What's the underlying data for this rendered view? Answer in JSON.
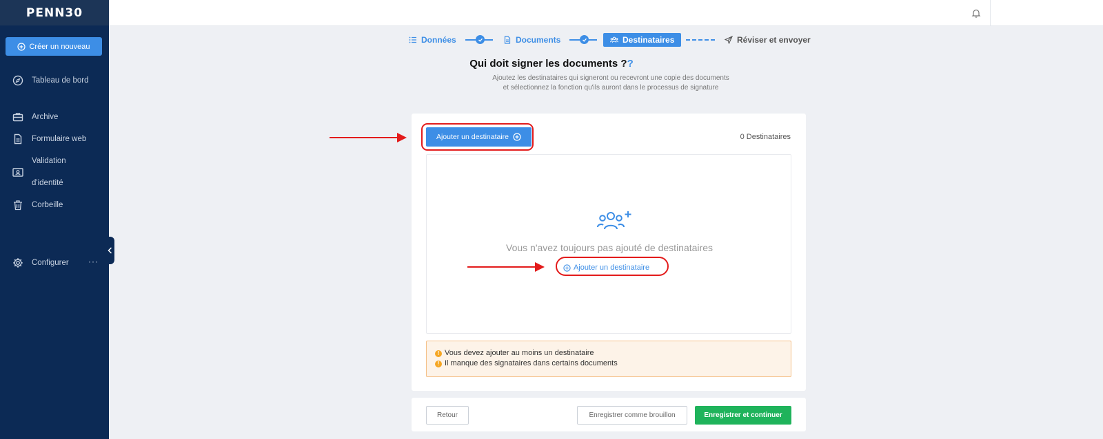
{
  "colors": {
    "sidebar_bg": "#0c2a55",
    "accent": "#3d8ee6",
    "success": "#1fb35b",
    "warning_bg": "#fdf3e8",
    "annotation": "#e31b1b"
  },
  "sidebar": {
    "logo": "PENN30",
    "create_label": "Créer un nouveau",
    "items": [
      {
        "label": "Tableau de bord",
        "icon": "compass-icon"
      },
      {
        "label": "Archive",
        "icon": "briefcase-icon"
      },
      {
        "label": "Formulaire web",
        "icon": "document-icon"
      },
      {
        "label": "Validation",
        "label2": "d'identité",
        "icon": "id-card-icon"
      },
      {
        "label": "Corbeille",
        "icon": "trash-icon"
      },
      {
        "label": "Configurer",
        "icon": "gear-icon"
      }
    ],
    "more": "···"
  },
  "stepper": {
    "steps": [
      {
        "label": "Données",
        "state": "done",
        "icon": "list-icon"
      },
      {
        "label": "Documents",
        "state": "done",
        "icon": "file-icon"
      },
      {
        "label": "Destinataires",
        "state": "active",
        "icon": "users-icon"
      },
      {
        "label": "Réviser et envoyer",
        "state": "pending",
        "icon": "send-icon"
      }
    ]
  },
  "main": {
    "title": "Qui doit signer les documents ?",
    "title_q": "?",
    "subtitle": "Ajoutez les destinataires qui signeront ou recevront une copie des documents et sélectionnez la fonction qu'ils auront dans le processus de signature",
    "add_button": "Ajouter un destinataire",
    "recipient_count": "0 Destinataires",
    "empty_text": "Vous n'avez toujours pas ajouté de destinataires",
    "add_link": "Ajouter un destinataire",
    "warnings": [
      "Vous devez ajouter au moins un destinataire",
      "Il manque des signataires dans certains documents"
    ]
  },
  "footer": {
    "back": "Retour",
    "draft": "Enregistrer comme brouillon",
    "save": "Enregistrer et continuer"
  }
}
